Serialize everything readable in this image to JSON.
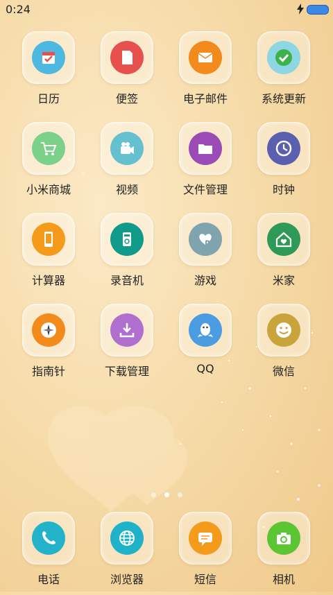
{
  "status_bar": {
    "time": "0:24"
  },
  "apps": [
    {
      "id": "calendar",
      "label": "日历",
      "color": "#4fb8e0",
      "icon": "calendar-icon"
    },
    {
      "id": "notes",
      "label": "便签",
      "color": "#e8504e",
      "icon": "note-icon"
    },
    {
      "id": "email",
      "label": "电子邮件",
      "color": "#f28a1c",
      "icon": "mail-icon"
    },
    {
      "id": "update",
      "label": "系统更新",
      "color": "#8dd6e4",
      "icon": "check-icon"
    },
    {
      "id": "mistore",
      "label": "小米商城",
      "color": "#7bd08a",
      "icon": "cart-icon"
    },
    {
      "id": "video",
      "label": "视频",
      "color": "#65c1cf",
      "icon": "video-camera-icon"
    },
    {
      "id": "files",
      "label": "文件管理",
      "color": "#9b4bb5",
      "icon": "folder-icon"
    },
    {
      "id": "clock",
      "label": "时钟",
      "color": "#5a5fb0",
      "icon": "clock-icon"
    },
    {
      "id": "calc",
      "label": "计算器",
      "color": "#f59b1c",
      "icon": "phone-calculator-icon"
    },
    {
      "id": "recorder",
      "label": "录音机",
      "color": "#0f9a8a",
      "icon": "recorder-icon"
    },
    {
      "id": "games",
      "label": "游戏",
      "color": "#7fa4ae",
      "icon": "heart-hand-icon"
    },
    {
      "id": "mihome",
      "label": "米家",
      "color": "#2f9a57",
      "icon": "home-icon"
    },
    {
      "id": "compass",
      "label": "指南针",
      "color": "#f28a1c",
      "icon": "compass-icon"
    },
    {
      "id": "downloads",
      "label": "下载管理",
      "color": "#b06ecf",
      "icon": "download-icon"
    },
    {
      "id": "qq",
      "label": "QQ",
      "color": "#4b9ce0",
      "icon": "penguin-icon"
    },
    {
      "id": "wechat",
      "label": "微信",
      "color": "#c9a43a",
      "icon": "smiley-icon"
    }
  ],
  "dock": [
    {
      "id": "phone",
      "label": "电话",
      "color": "#22b2c9",
      "icon": "phone-icon"
    },
    {
      "id": "browser",
      "label": "浏览器",
      "color": "#1fb2c9",
      "icon": "globe-icon"
    },
    {
      "id": "sms",
      "label": "短信",
      "color": "#f59b1c",
      "icon": "message-icon"
    },
    {
      "id": "camera",
      "label": "相机",
      "color": "#5cc534",
      "icon": "camera-icon"
    }
  ],
  "pager": {
    "count": 3,
    "active": 2
  }
}
